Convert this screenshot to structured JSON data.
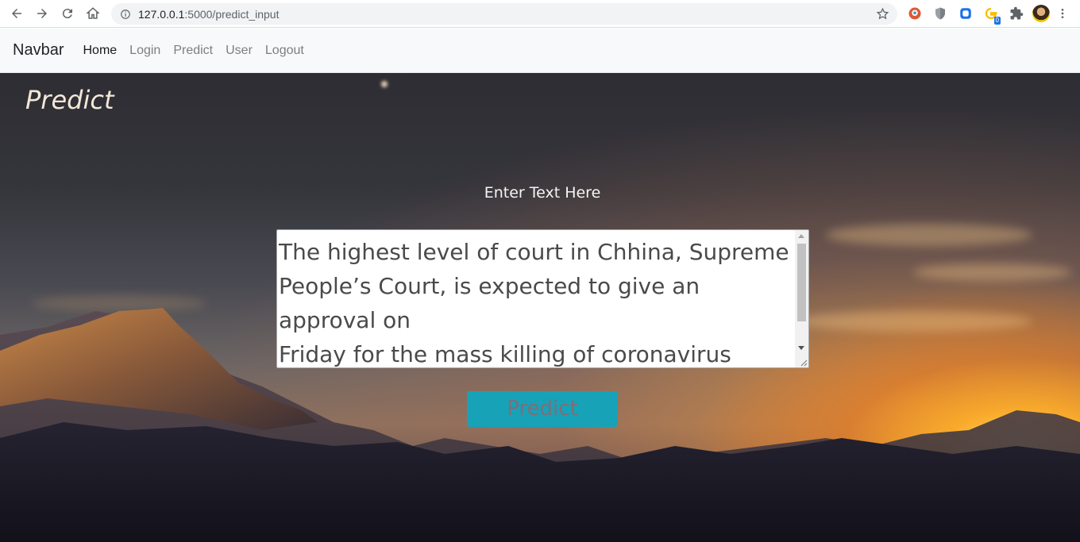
{
  "browser": {
    "url_host": "127.0.0.1",
    "url_path": ":5000/predict_input",
    "extension_badge": "0"
  },
  "navbar": {
    "brand": "Navbar",
    "links": [
      "Home",
      "Login",
      "Predict",
      "User",
      "Logout"
    ]
  },
  "page": {
    "title": "Predict",
    "input_label": "Enter Text Here",
    "input_value": "The highest level of court in Chhina, Supreme\nPeople’s Court, is expected to give an approval on\nFriday for the mass killing of coronavirus patients\nin China as sure means of controlling the spread of",
    "submit_label": "Predict"
  },
  "colors": {
    "button": "#17a2b8",
    "navbar_bg": "#f8f9fa"
  }
}
